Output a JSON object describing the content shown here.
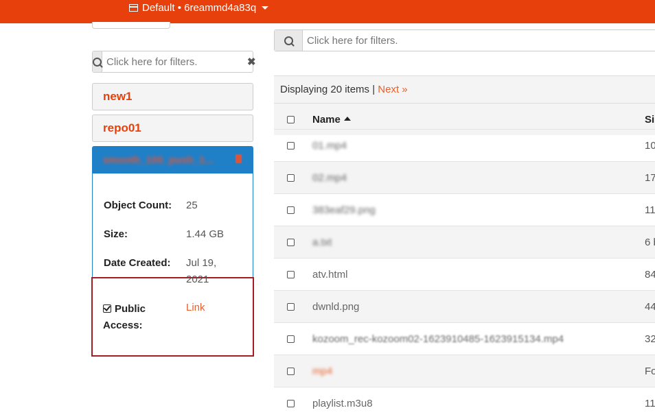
{
  "header": {
    "project_label": "Default • 6reammd4a83q"
  },
  "left_filter": {
    "placeholder": "Click here for filters."
  },
  "main_filter": {
    "placeholder": "Click here for filters."
  },
  "buckets": [
    {
      "name": "new1"
    },
    {
      "name": "repo01"
    },
    {
      "name": "smooth_100_push_1..."
    }
  ],
  "details": {
    "object_count_label": "Object Count:",
    "object_count": "25",
    "size_label": "Size:",
    "size": "1.44 GB",
    "date_label": "Date Created:",
    "date_line1": "Jul 19,",
    "date_line2": "2021",
    "public_label_line1": "Public",
    "public_label_line2": "Access:",
    "public_link": "Link"
  },
  "table": {
    "displaying_text": "Displaying 20 items |",
    "next_label": "Next »",
    "columns": {
      "name": "Name",
      "size": "Si"
    },
    "rows": [
      {
        "name": "01.mp4",
        "size": "10"
      },
      {
        "name": "02.mp4",
        "size": "17"
      },
      {
        "name": "383eaf29.png",
        "size": "11"
      },
      {
        "name": "a.txt",
        "size": "6 b"
      },
      {
        "name": "atv.html",
        "size": "84"
      },
      {
        "name": "dwnld.png",
        "size": "44"
      },
      {
        "name": "kozoom_rec-kozoom02-1623910485-1623915134.mp4",
        "size": "32"
      },
      {
        "name": "mp4",
        "size": "Fo"
      },
      {
        "name": "playlist.m3u8",
        "size": "11"
      }
    ]
  },
  "colors": {
    "brand": "#e8400c",
    "selected_bucket": "#1f80c8",
    "highlight_border": "#a41c22"
  }
}
